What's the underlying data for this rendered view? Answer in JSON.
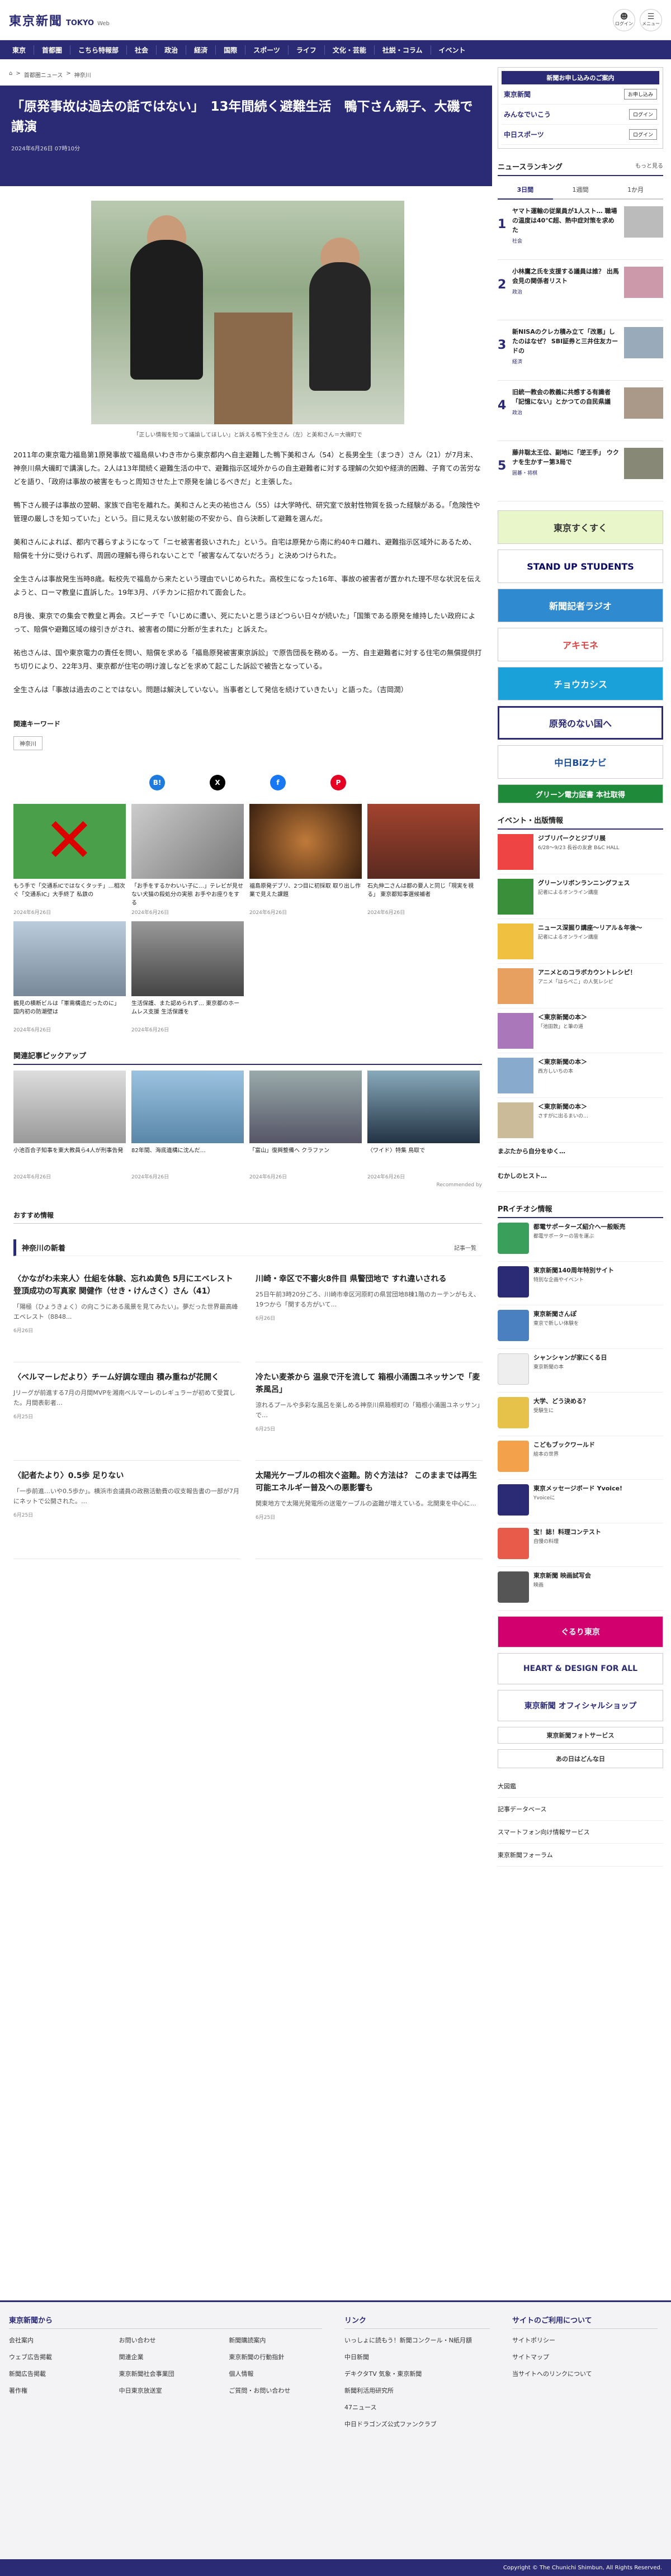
{
  "header": {
    "logo_jp": "東京新聞",
    "logo_en": "TOKYO",
    "logo_sub": "Web",
    "login": "ログイン",
    "menu": "メニュー"
  },
  "nav": [
    "東京",
    "首都圏",
    "こちら特報部",
    "社会",
    "政治",
    "経済",
    "国際",
    "スポーツ",
    "ライフ",
    "文化・芸能",
    "社説・コラム",
    "イベント"
  ],
  "breadcrumb": [
    "首都圏ニュース",
    "神奈川"
  ],
  "article": {
    "title": "「原発事故は過去の話ではない」　13年間続く避難生活　鴨下さん親子、大磯で講演",
    "date": "2024年6月26日 07時10分",
    "caption": "「正しい情報を知って議論してほしい」と訴える鴨下全生さん（左）と美和さん＝大磯町で",
    "paragraphs": [
      "2011年の東京電力福島第1原発事故で福島県いわき市から東京都内へ自主避難した鴨下美和さん（54）と長男全生（まつき）さん（21）が7月末、神奈川県大磯町で講演した。2人は13年間続く避難生活の中で、避難指示区域外からの自主避難者に対する理解の欠如や経済的困難、子育ての苦労などを語り、「政府は事故の被害をもっと周知させた上で原発を論じるべきだ」と主張した。",
      "鴨下さん親子は事故の翌朝、家族で自宅を離れた。美和さんと夫の祐也さん（55）は大学時代、研究室で放射性物質を扱った経験がある。「危険性や管理の厳しさを知っていた」という。目に見えない放射能の不安から、自ら決断して避難を選んだ。",
      "美和さんによれば、都内で暮らすようになって「ニセ被害者扱いされた」という。自宅は原発から南に約40キロ離れ、避難指示区域外にあるため、賠償を十分に受けられず、周囲の理解も得られないことで「被害なんてないだろう」と決めつけられた。",
      "全生さんは事故発生当時8歳。転校先で福島から来たという理由でいじめられた。高校生になった16年、事故の被害者が置かれた理不尽な状況を伝えようと、ローマ教皇に直訴した。19年3月、バチカンに招かれて面会した。",
      "8月後、東京での集会で教皇と再会。スピーチで「いじめに遭い、死にたいと思うほどつらい日々が続いた」「国策である原発を維持したい政府によって、賠償や避難区域の線引きがされ、被害者の間に分断が生まれた」と訴えた。",
      "祐也さんは、国や東京電力の責任を問い、賠償を求める「福島原発被害東京訴訟」で原告団長を務める。一方、自主避難者に対する住宅の無償提供打ち切りにより、22年3月、東京都が住宅の明け渡しなどを求めて起こした訴訟で被告となっている。",
      "全生さんは「事故は過去のことではない。問題は解決していない。当事者として発信を続けていきたい」と語った。（吉岡潤）"
    ]
  },
  "keywords": {
    "heading": "関連キーワード",
    "tags": [
      "神奈川"
    ]
  },
  "share": {
    "b": "B!",
    "x": "X",
    "f": "f",
    "p": "P"
  },
  "cards": [
    {
      "t": "もう手で「交通系ICではなくタッチ」…相次ぐ「交通系IC」大手終了 私鉄の",
      "d": "2024年6月26日"
    },
    {
      "t": "「お手をするかわいい子に…」テレビが見せない犬猫の殺処分の実態 お手やお座りをする",
      "d": "2024年6月26日"
    },
    {
      "t": "福島原発デブリ、2つ目に初採取 取り出し作業で見えた課題",
      "d": "2024年6月26日"
    },
    {
      "t": "石丸伸二さんは都の要人と同じ「現実を視る」 東京都知事選候補者",
      "d": "2024年6月26日"
    },
    {
      "t": "鶴見の横断ビルは「軍需構造だったのに」 国内初の防潮壁は",
      "d": "2024年6月26日"
    },
    {
      "t": "生活保護、また認められず… 東京都のホームレス支援 生活保護を",
      "d": "2024年6月26日"
    }
  ],
  "picks": {
    "heading": "関連記事ピックアップ",
    "items": [
      {
        "t": "小池百合子知事を東大教員ら4人が刑事告発",
        "d": "2024年6月26日"
      },
      {
        "t": "82年間、海底遺構に沈んだ…",
        "d": "2024年6月26日"
      },
      {
        "t": "「富山」復興整備へ クラファン",
        "d": "2024年6月26日"
      },
      {
        "t": "〈ワイド〉特集 鳥取で",
        "d": "2024年6月26日"
      }
    ],
    "rec": "Recommended by"
  },
  "osusume": "おすすめ情報",
  "kanagawa": {
    "heading": "神奈川の新着",
    "more": "記事一覧",
    "items": [
      {
        "h": "〈かながわ未来人〉仕組を体験、忘れぬ黄色 5月にエベレスト登頂成功の写真家 関健作（せき・けんさく）さん（41）",
        "p": "「陽極（ひょうきょく）の向こうにある風景を見てみたい」。夢だった世界最高峰エベレスト（8848...",
        "d": "6月26日"
      },
      {
        "h": "川崎・幸区で不審火8件目 県警団地で すれ違いされる",
        "p": "25日午前3時20分ごろ、川崎市幸区河原町の県営団地8棟1階のカーテンがもえ、19つから「関する方がいて...",
        "d": "6月26日"
      },
      {
        "h": "〈ベルマーレだより〉チーム好調な理由 積み重ねが花開く",
        "p": "Jリーグが前進する7月の月間MVPを湘南ベルマーレのレギュラーが初めて受賞した。月間表彰者…",
        "d": "6月25日"
      },
      {
        "h": "冷たい麦茶から 温泉で汗を流して 箱根小涌園ユネッサンで「麦茶風呂」",
        "p": "涼れるプールや多彩な風呂を楽しめる神奈川県箱根町の「箱根小涌園ユネッサン」で…",
        "d": "6月25日"
      },
      {
        "h": "〈記者たより〉0.5歩 足りない",
        "p": "「一歩前進…いや0.5歩か」。横浜市会議員の政務活動費の収支報告書の一部が7月にネットで公開された。…",
        "d": "6月25日"
      },
      {
        "h": "太陽光ケーブルの相次ぐ盗難。防ぐ方法は？ このままでは再生可能エネルギー普及への悪影響も",
        "p": "関東地方で太陽光発電所の送電ケーブルの盗難が増えている。北関東を中心に…",
        "d": "6月25日"
      }
    ]
  },
  "side": {
    "adhead": "新聞お申し込みのご案内",
    "adrows": [
      {
        "l": "東京新聞",
        "b": "お申し込み"
      },
      {
        "l": "みんなでいこう",
        "b": "ログイン"
      },
      {
        "l": "中日スポーツ",
        "b": "ログイン"
      }
    ],
    "ranking": {
      "heading": "ニュースランキング",
      "more": "もっと見る",
      "tabs": [
        "3日間",
        "1週間",
        "1か月"
      ],
      "items": [
        {
          "n": "1",
          "h": "ヤマト運輸の従業員が1人スト… 職場の温度は40℃超、熱中症対策を求めた",
          "c": "社会"
        },
        {
          "n": "2",
          "h": "小林鷹之氏を支援する議員は誰？ 出馬会見の関係者リスト",
          "c": "政治"
        },
        {
          "n": "3",
          "h": "新NISAのクレカ積み立て「改悪」したのはなぜ？ SBI証券と三井住友カードの",
          "c": "経済"
        },
        {
          "n": "4",
          "h": "旧統一教会の教義に共感する有識者「記憶にない」とかつての自民県議",
          "c": "政治"
        },
        {
          "n": "5",
          "h": "藤井聡太王位、副地に「逆王手」 ウクナを生かすー第3局で",
          "c": "囲碁・将棋"
        }
      ]
    },
    "banners": [
      "東京すくすく",
      "STAND UP STUDENTS",
      "新聞記者ラジオ",
      "アキモネ",
      "チョウカシス",
      "原発のない国へ",
      "中日BiZナビ",
      "グリーン電力証書 本社取得"
    ],
    "events": {
      "heading": "イベント・出版情報",
      "items": [
        {
          "h": "ジブリパークとジブリ展",
          "p": "6/28〜9/23 長谷の友倉 B&C HALL"
        },
        {
          "h": "グリーンリボンランニングフェス",
          "p": "記者によるオンライン講座"
        },
        {
          "h": "ニュース深掘り講座〜リアル＆年後〜",
          "p": "記者によるオンライン講座"
        },
        {
          "h": "アニメとのコラボカウントレシピ！",
          "p": "アニメ「はらぺこ」の人気レシピ"
        },
        {
          "h": "＜東京新聞の本＞",
          "p": "「池田敦」と筆の道"
        },
        {
          "h": "＜東京新聞の本＞",
          "p": "西方しいちの本"
        },
        {
          "h": "＜東京新聞の本＞",
          "p": "さすがに出るまいの…"
        }
      ]
    },
    "extra": [
      "まぶたから自分をゆく…",
      "むかしのヒスト…"
    ],
    "pr": {
      "heading": "PRイチオシ情報",
      "items": [
        {
          "h": "都電サポーターズ紹介へ一般販売",
          "p": "都電サポーターの皆を運ぶ"
        },
        {
          "h": "東京新聞140周年特別サイト",
          "p": "特別な企画やイベント"
        },
        {
          "h": "東京新聞さんぽ",
          "p": "東京で新しい体験を"
        },
        {
          "h": "シャンシャンが家にくる日",
          "p": "東京新聞の本"
        },
        {
          "h": "大学、どう決める？",
          "p": "受験生に"
        },
        {
          "h": "こどもブックワールド",
          "p": "絵本の世界"
        },
        {
          "h": "東京メッセージボード Yvoice!",
          "p": "Yvoiceに"
        },
        {
          "h": "宝！誌！料理コンテスト",
          "p": "自慢の料理"
        },
        {
          "h": "東京新聞 映画試写会",
          "p": "映画"
        }
      ]
    },
    "banners2": [
      "ぐるり東京",
      "HEART & DESIGN FOR ALL",
      "東京新聞 オフィシャルショップ",
      "東京新聞フォトサービス",
      "あの日はどんな日"
    ],
    "links": [
      "大図鑑",
      "記事データベース",
      "スマートフォン向け情報サービス",
      "東京新聞フォーラム"
    ]
  },
  "footer": {
    "col1": {
      "heading": "東京新聞から",
      "items": [
        "会社案内",
        "お問い合わせ",
        "新聞購読案内",
        "ウェブ広告掲載",
        "関連企業",
        "東京新聞の行動指針",
        "新聞広告掲載",
        "東京新聞社会事業団",
        "個人情報",
        "著作権",
        "中日東京放送室",
        "ご質問・お問い合わせ"
      ]
    },
    "col2": {
      "heading": "リンク",
      "items": [
        "いっしょに読もう！新聞コンクール・N紙月額",
        "中日新聞",
        "デキクタTV 気象・東京新聞",
        "新聞利活用研究所",
        "47ニュース",
        "中日ドラゴンズ公式ファンクラブ"
      ]
    },
    "col3": {
      "heading": "サイトのご利用について",
      "items": [
        "サイトポリシー",
        "サイトマップ",
        "当サイトへのリンクについて"
      ]
    },
    "copyright": "Copyright © The Chunichi Shimbun, All Rights Reserved."
  }
}
